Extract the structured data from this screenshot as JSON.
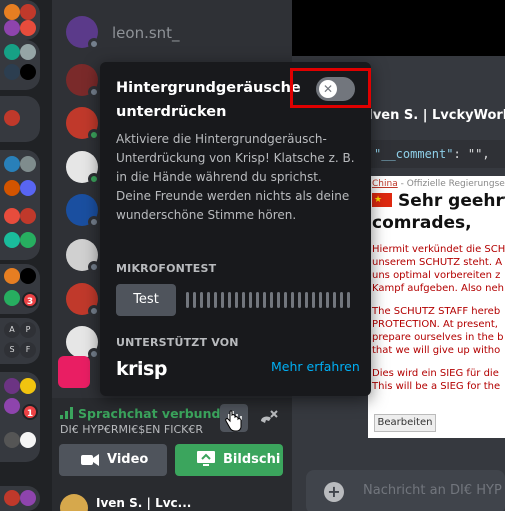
{
  "colors": {
    "accent_green": "#3ba55d",
    "link_blue": "#00aff4",
    "danger_red": "#e00000",
    "popover_bg": "#18191c"
  },
  "members": [
    {
      "name": "leon.snt_",
      "avatar_color": "#5b3a8a"
    },
    {
      "name": "",
      "avatar_color": "#7a2a2a"
    },
    {
      "name": "",
      "avatar_color": "#c0392b"
    },
    {
      "name": "",
      "avatar_color": "#e6e6e6"
    },
    {
      "name": "",
      "avatar_color": "#1a4fa0"
    },
    {
      "name": "",
      "avatar_color": "#d0d0d0"
    },
    {
      "name": "",
      "avatar_color": "#c0392b"
    },
    {
      "name": "",
      "avatar_color": "#e6e6e6"
    }
  ],
  "server_letters": [
    "A",
    "P",
    "S",
    "F"
  ],
  "server_badges": [
    "3",
    "1"
  ],
  "popover": {
    "title": "Hintergrundgeräusche unterdrücken",
    "toggle_state": "off",
    "description": "Aktiviere die Hintergrundgeräusch-Unterdrückung von Krisp! Klatsche z. B. in die Hände während du sprichst. Deine Freunde werden nichts als deine wunderschöne Stimme hören.",
    "mic_section": "MIKROFONTEST",
    "test_button": "Test",
    "support_section": "UNTERSTÜTZT VON",
    "brand": "krisp",
    "learn_more": "Mehr erfahren"
  },
  "voice": {
    "status": "Sprachchat verbunden",
    "channel": "DI€ HYP€RMI€$EN FICK€R",
    "video_label": "Video",
    "share_label": "Bildschi"
  },
  "userbar": {
    "name": "Iven S. | Lvc..."
  },
  "chat": {
    "author": "Iven S. | LvckyWorld",
    "code_key": "\"__comment\"",
    "code_rest": ": \"\",",
    "doc_source": "China",
    "doc_source_rest": " - Offizielle Regierungse",
    "doc_title_1": "Sehr geehrt",
    "doc_title_2": "comrades,",
    "doc_lines_1": [
      "Hiermit verkündet die SCH",
      "unserem SCHUTZ steht. A",
      "uns optimal vorbereiten z",
      "Kampf aufgeben. Also neh"
    ],
    "doc_lines_2": [
      "The SCHUTZ STAFF hereb",
      "PROTECTION. At present,",
      "prepare ourselves in the b",
      "that we will give up witho"
    ],
    "doc_lines_3": [
      "Dies wird ein SIEG für die",
      "This will be a SIEG for the"
    ],
    "edit_button": "Bearbeiten",
    "input_placeholder": "Nachricht an DI€ HYP"
  }
}
